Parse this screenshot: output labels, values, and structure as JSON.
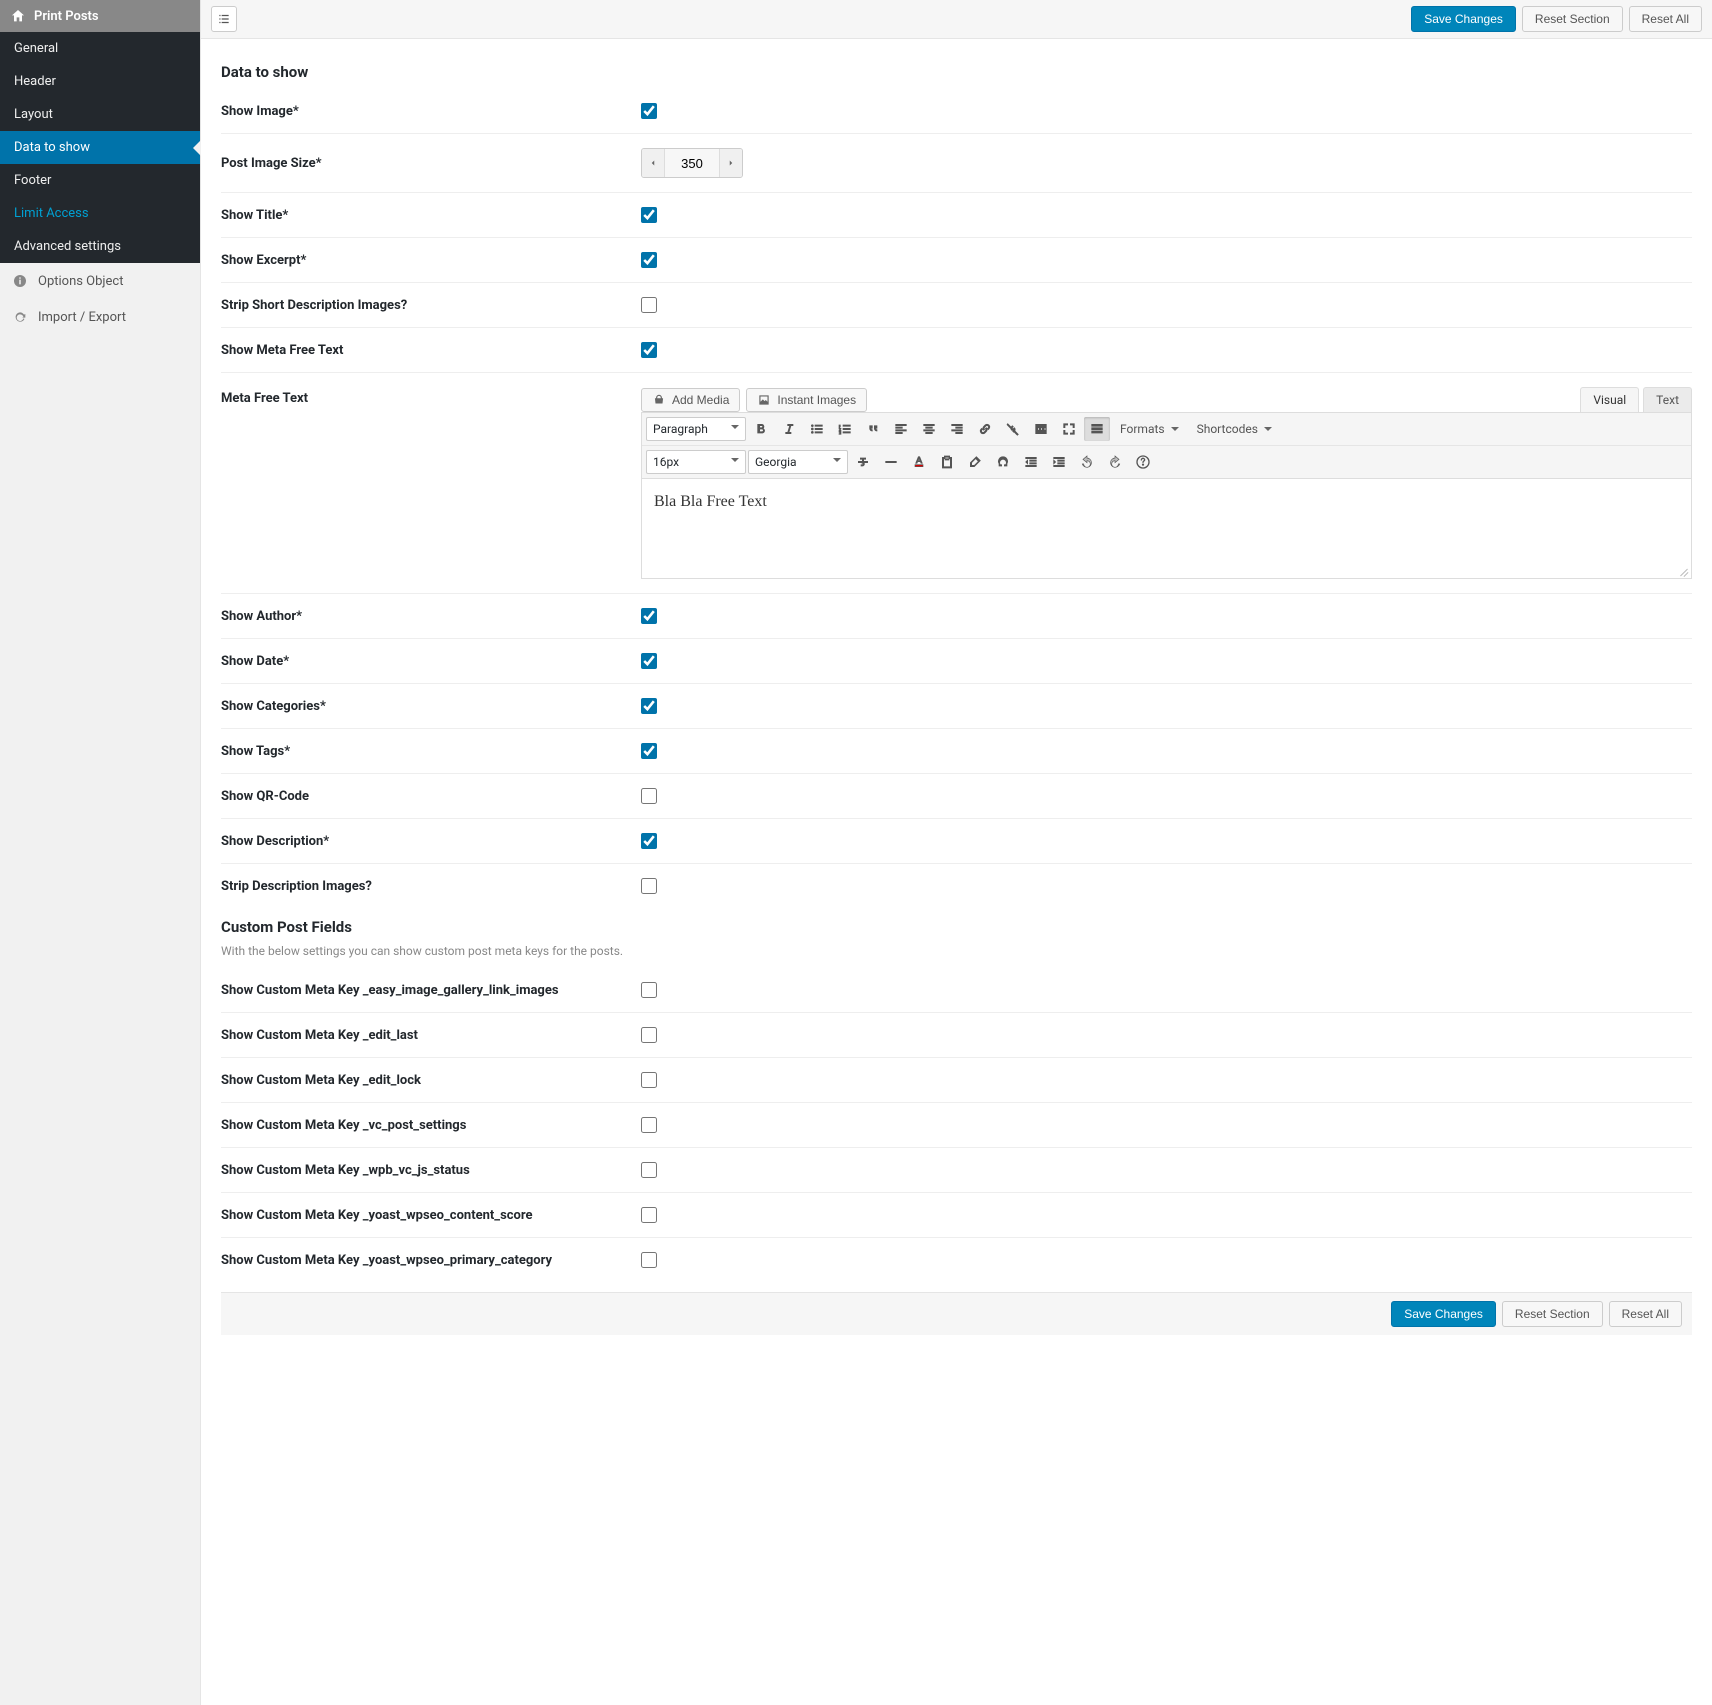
{
  "sidebar": {
    "title": "Print Posts",
    "items": [
      {
        "label": "General",
        "active": false
      },
      {
        "label": "Header",
        "active": false
      },
      {
        "label": "Layout",
        "active": false
      },
      {
        "label": "Data to show",
        "active": true
      },
      {
        "label": "Footer",
        "active": false
      },
      {
        "label": "Limit Access",
        "active": false,
        "accent": true
      },
      {
        "label": "Advanced settings",
        "active": false
      }
    ],
    "extra": [
      {
        "label": "Options Object",
        "icon": "info"
      },
      {
        "label": "Import / Export",
        "icon": "refresh"
      }
    ]
  },
  "actions": {
    "save": "Save Changes",
    "reset_section": "Reset Section",
    "reset_all": "Reset All"
  },
  "section1": {
    "title": "Data to show",
    "fields": {
      "show_image": {
        "label": "Show Image*",
        "checked": true
      },
      "post_image_size": {
        "label": "Post Image Size*",
        "value": "350"
      },
      "show_title": {
        "label": "Show Title*",
        "checked": true
      },
      "show_excerpt": {
        "label": "Show Excerpt*",
        "checked": true
      },
      "strip_short_desc": {
        "label": "Strip Short Description Images?",
        "checked": false
      },
      "show_meta_free": {
        "label": "Show Meta Free Text",
        "checked": true
      },
      "meta_free_text": {
        "label": "Meta Free Text",
        "content": "Bla Bla Free Text"
      },
      "show_author": {
        "label": "Show Author*",
        "checked": true
      },
      "show_date": {
        "label": "Show Date*",
        "checked": true
      },
      "show_categories": {
        "label": "Show Categories*",
        "checked": true
      },
      "show_tags": {
        "label": "Show Tags*",
        "checked": true
      },
      "show_qr": {
        "label": "Show QR-Code",
        "checked": false
      },
      "show_description": {
        "label": "Show Description*",
        "checked": true
      },
      "strip_desc_images": {
        "label": "Strip Description Images?",
        "checked": false
      }
    }
  },
  "editor": {
    "add_media": "Add Media",
    "instant_images": "Instant Images",
    "tabs": {
      "visual": "Visual",
      "text": "Text"
    },
    "paragraph": "Paragraph",
    "font_size": "16px",
    "font_family": "Georgia",
    "formats": "Formats",
    "shortcodes": "Shortcodes"
  },
  "section2": {
    "title": "Custom Post Fields",
    "desc": "With the below settings you can show custom post meta keys for the posts.",
    "fields": [
      {
        "label": "Show Custom Meta Key _easy_image_gallery_link_images",
        "checked": false
      },
      {
        "label": "Show Custom Meta Key _edit_last",
        "checked": false
      },
      {
        "label": "Show Custom Meta Key _edit_lock",
        "checked": false
      },
      {
        "label": "Show Custom Meta Key _vc_post_settings",
        "checked": false
      },
      {
        "label": "Show Custom Meta Key _wpb_vc_js_status",
        "checked": false
      },
      {
        "label": "Show Custom Meta Key _yoast_wpseo_content_score",
        "checked": false
      },
      {
        "label": "Show Custom Meta Key _yoast_wpseo_primary_category",
        "checked": false
      }
    ]
  }
}
